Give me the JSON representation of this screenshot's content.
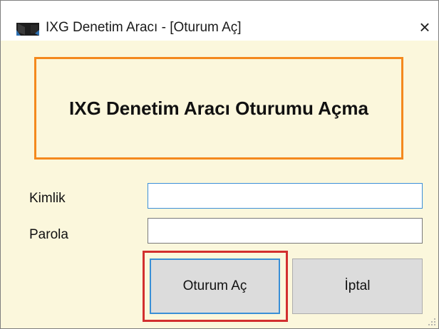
{
  "window": {
    "title": "IXG Denetim Aracı - [Oturum Aç]",
    "close_symbol": "×"
  },
  "header": {
    "text": "IXG Denetim Aracı Oturumu Açma"
  },
  "form": {
    "id_label": "Kimlik",
    "id_value": "",
    "password_label": "Parola",
    "password_value": ""
  },
  "buttons": {
    "login_label": "Oturum Aç",
    "cancel_label": "İptal"
  },
  "icons": {
    "app": "app-icon",
    "close": "close-icon",
    "resize": "resize-grip-icon"
  },
  "colors": {
    "window_bg": "#fbf7dc",
    "header_border": "#f4891e",
    "focus_border": "#3a8fd6",
    "highlight": "#d22f2f"
  }
}
